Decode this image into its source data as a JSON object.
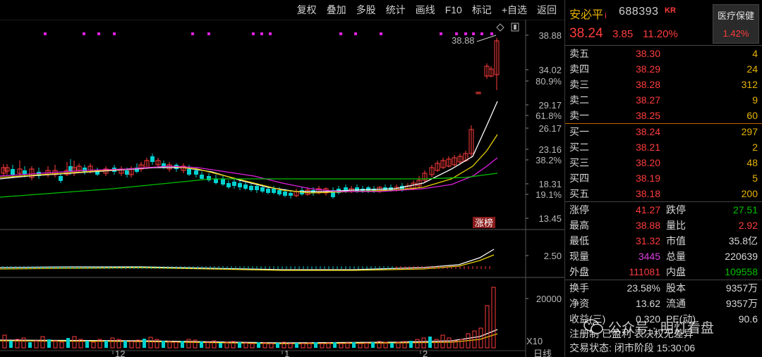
{
  "toolbar": [
    "复权",
    "叠加",
    "多股",
    "统计",
    "画线",
    "F10",
    "标记",
    "+自选",
    "返回"
  ],
  "stock": {
    "name": "安必平",
    "name_mark": "i",
    "code": "688393",
    "badge": "KR",
    "price": "38.24",
    "change": "3.85",
    "pct": "11.20%"
  },
  "sector": {
    "name": "医疗保健",
    "pct": "1.42%"
  },
  "sell": [
    {
      "label": "卖五",
      "price": "38.30",
      "vol": "4"
    },
    {
      "label": "卖四",
      "price": "38.29",
      "vol": "24"
    },
    {
      "label": "卖三",
      "price": "38.28",
      "vol": "312"
    },
    {
      "label": "卖二",
      "price": "38.27",
      "vol": "9"
    },
    {
      "label": "卖一",
      "price": "38.25",
      "vol": "60"
    }
  ],
  "buy": [
    {
      "label": "买一",
      "price": "38.24",
      "vol": "297"
    },
    {
      "label": "买二",
      "price": "38.21",
      "vol": "2"
    },
    {
      "label": "买三",
      "price": "38.20",
      "vol": "48"
    },
    {
      "label": "买四",
      "price": "38.19",
      "vol": "5"
    },
    {
      "label": "买五",
      "price": "38.18",
      "vol": "200"
    }
  ],
  "stats": {
    "r1": {
      "l": "涨停",
      "v": "41.27",
      "l2": "跌停",
      "v2": "27.51"
    },
    "r2": {
      "l": "最高",
      "v": "38.88",
      "l2": "量比",
      "v2": "2.92"
    },
    "r3": {
      "l": "最低",
      "v": "31.32",
      "l2": "市值",
      "v2": "35.8亿"
    },
    "r4": {
      "l": "现量",
      "v": "3445",
      "l2": "总量",
      "v2": "220639"
    },
    "r5": {
      "l": "外盘",
      "v": "111081",
      "l2": "内盘",
      "v2": "109558"
    },
    "r6": {
      "l": "换手",
      "v": "23.58%",
      "l2": "股本",
      "v2": "9357万"
    },
    "r7": {
      "l": "净资",
      "v": "13.62",
      "l2": "流通",
      "v2": "9357万"
    },
    "r8": {
      "l": "收益(三)",
      "v": "0.320",
      "l2": "PE(动)",
      "v2": "90.6"
    }
  },
  "footer": {
    "line1": "注册制 已盈利 表决权无差异",
    "line2": "交易状态: 闭市阶段 15:30:06"
  },
  "watermark": "公众号 · 明灯看盘",
  "chart": {
    "price_labels": [
      "38.88",
      "34.02",
      "80.9%",
      "29.17",
      "61.8%",
      "26.17",
      "23.16",
      "38.2%",
      "18.31",
      "19.1%",
      "13.45"
    ],
    "high_marker": "38.88",
    "tag": "涨榜",
    "ind_label": "2.50",
    "vol_label": "20000",
    "vol_unit": "X10",
    "mode": "日线",
    "x_labels": [
      "12",
      "1",
      "2"
    ]
  },
  "colors": {
    "up": "#ff3c3c",
    "down": "#00d0d0",
    "ma5": "#ffffff",
    "ma10": "#e8d000",
    "ma20": "#e020e0",
    "ma60": "#00c000",
    "dot": "#e020e0"
  }
}
